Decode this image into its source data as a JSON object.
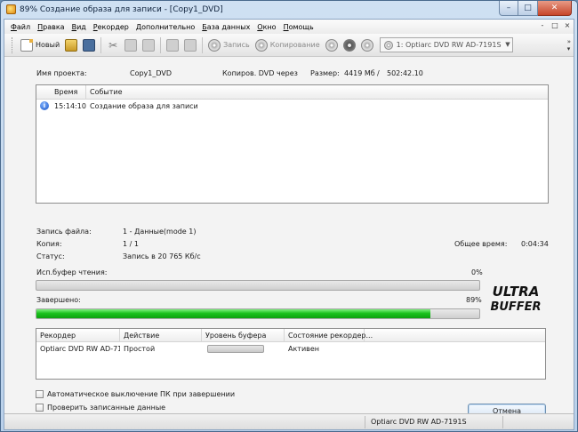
{
  "window": {
    "title": "89% Создание образа для записи - [Copy1_DVD]",
    "minimize": "–",
    "maximize": "□",
    "close": "✕"
  },
  "menu": {
    "items": [
      {
        "u": "Ф",
        "rest": "айл"
      },
      {
        "u": "П",
        "rest": "равка"
      },
      {
        "u": "В",
        "rest": "ид"
      },
      {
        "u": "Р",
        "rest": "екордер"
      },
      {
        "u": "Д",
        "rest": "ополнительно"
      },
      {
        "u": "Б",
        "rest": "аза данных"
      },
      {
        "u": "О",
        "rest": "кно"
      },
      {
        "u": "П",
        "rest": "омощь"
      }
    ],
    "right_icons": [
      "-",
      "□",
      "×"
    ]
  },
  "toolbar": {
    "new_label": "Новый",
    "burn_label": "Запись",
    "copy_label": "Копирование",
    "drive_select": "1: Optiarc DVD RW AD-7191S"
  },
  "project": {
    "name_label": "Имя проекта:",
    "name_value": "Copy1_DVD",
    "copy_via_label": "Копиров. DVD через",
    "size_label": "Размер:",
    "size_mb": "4419 Мб",
    "size_sep": "/",
    "size_time": "502:42.10"
  },
  "log": {
    "col_time": "Время",
    "col_event": "Событие",
    "rows": [
      {
        "time": "15:14:10",
        "event": "Создание образа для записи"
      }
    ]
  },
  "status": {
    "file_label": "Запись файла:",
    "file_value": "1 - Данные(mode 1)",
    "copy_label": "Копия:",
    "copy_value": "1 / 1",
    "state_label": "Статус:",
    "state_value": "Запись в 20 765 Кб/с",
    "total_time_label": "Общее время:",
    "total_time_value": "0:04:34"
  },
  "buffer": {
    "label": "Исп.буфер чтения:",
    "percent_text": "0%",
    "value": 0
  },
  "complete": {
    "label": "Завершено:",
    "percent_text": "89%",
    "value": 89
  },
  "logo": {
    "line1": "ULTRA",
    "line2": "BUFFER"
  },
  "devices": {
    "col_recorder": "Рекордер",
    "col_action": "Действие",
    "col_buffer": "Уровень буфера",
    "col_state": "Состояние рекордер...",
    "rows": [
      {
        "recorder": "Optiarc DVD RW AD-71...",
        "action": "Простой",
        "state": "Активен"
      }
    ]
  },
  "options": {
    "auto_shutdown": "Автоматическое выключение ПК при завершении",
    "verify": "Проверить записанные данные"
  },
  "cancel_label": "Отмена",
  "statusbar": {
    "drive": "Optiarc  DVD RW AD-7191S"
  }
}
